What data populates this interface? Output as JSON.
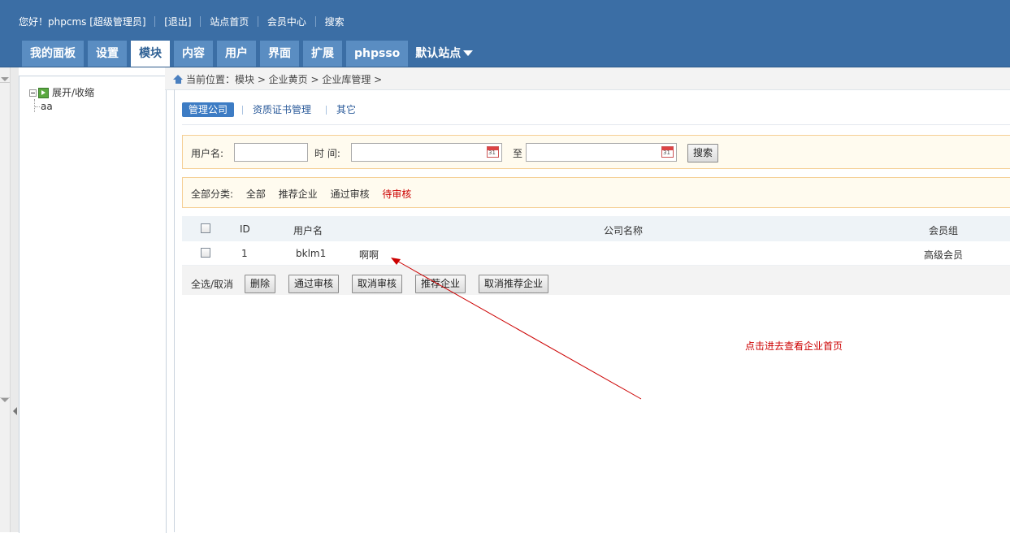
{
  "topbar": {
    "greeting": "您好！phpcms [超级管理员]",
    "logout": "[退出]",
    "site_home": "站点首页",
    "member_center": "会员中心",
    "search": "搜索"
  },
  "nav": {
    "tabs": [
      "我的面板",
      "设置",
      "模块",
      "内容",
      "用户",
      "界面",
      "扩展",
      "phpsso"
    ],
    "active_index": 2,
    "site_selector": "默认站点"
  },
  "sidebar": {
    "toggle_label": "展开/收缩",
    "items": [
      "aa"
    ]
  },
  "breadcrumb": {
    "text": "当前位置：模块 > 企业黄页 > 企业库管理 >"
  },
  "subtabs": {
    "items": [
      "管理公司",
      "资质证书管理",
      "其它"
    ],
    "active_index": 0
  },
  "search": {
    "username_label": "用户名:",
    "username_value": "",
    "time_label": "时 间:",
    "start_value": "",
    "to_label": "至",
    "end_value": "",
    "button": "搜索"
  },
  "categories": {
    "label": "全部分类:",
    "items": [
      "全部",
      "推荐企业",
      "通过审核",
      "待审核"
    ],
    "highlight_color": "#cc0000"
  },
  "table": {
    "headers": [
      "ID",
      "用户名",
      "公司名称",
      "会员组"
    ],
    "rows": [
      {
        "id": "1",
        "username": "bklm1",
        "company": "啊啊",
        "group": "高级会员"
      }
    ]
  },
  "actions": {
    "select_all": "全选/取消",
    "buttons": [
      "删除",
      "通过审核",
      "取消审核",
      "推荐企业",
      "取消推荐企业"
    ]
  },
  "annotation": {
    "text": "点击进去查看企业首页",
    "color": "#cc0000"
  },
  "colors": {
    "header_bg": "#3b6ea5",
    "tab_bg": "#5a8dc2",
    "active_subtab": "#3d7cc4"
  }
}
